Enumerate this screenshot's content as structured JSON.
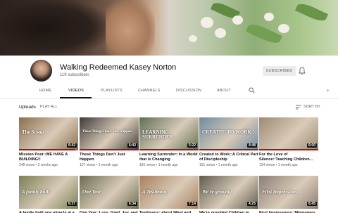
{
  "channel": {
    "name": "Walking Redeemed Kasey Norton",
    "subscribers": "119 subscribers",
    "subscribe_label": "SUBSCRIBED",
    "bell_icon": "bell-icon"
  },
  "tabs": [
    {
      "label": "HOME"
    },
    {
      "label": "VIDEOS"
    },
    {
      "label": "PLAYLISTS"
    },
    {
      "label": "CHANNELS"
    },
    {
      "label": "DISCUSSION"
    },
    {
      "label": "ABOUT"
    }
  ],
  "active_tab": "VIDEOS",
  "section": {
    "title": "Uploads",
    "play_all": "PLAY ALL",
    "sort_label": "SORT BY"
  },
  "videos_row1": [
    {
      "title": "Mission Post::WE HAVE A BUILDING!!",
      "meta": "248 views • 2 weeks ago",
      "duration": "6:42",
      "progress": 0.95,
      "overlay": "The Scoop",
      "accent": "#8b6f4e"
    },
    {
      "title": "These Things Don't Just Happen",
      "meta": "157 views • 1 month ago",
      "duration": "6:43",
      "progress": 1.0,
      "overlay": "These Things Don't Just Happen",
      "accent": "#3e3a38"
    },
    {
      "title": "Learning Surrender::In a World that is Changing",
      "meta": "166 views • 1 month ago",
      "duration": "5:22",
      "progress": 1.0,
      "overlay": "LEARNING SURRENDER",
      "accent": "#5f6e52"
    },
    {
      "title": "Created to Work::A Critical Part of Discipleship",
      "meta": "151 views • 1 month ago",
      "duration": "4:48",
      "progress": 1.0,
      "overlay": "CREATED TO WORK",
      "accent": "#6e8aa0"
    },
    {
      "title": "For the Love of Silence::Teaching Children...",
      "meta": "134 views • 1 month ago",
      "duration": "6:00",
      "progress": 1.0,
      "overlay": "",
      "accent": "#9c8a73"
    }
  ],
  "videos_row2": [
    {
      "title": "A family built one miracle at a",
      "meta": "",
      "duration": "6:37",
      "progress": 0.0,
      "overlay": "A family built",
      "accent": "#7a7f55"
    },
    {
      "title": "One Year::Loss, Grief, Joy, and",
      "meta": "",
      "duration": "6:34",
      "progress": 0.0,
      "overlay": "One Year",
      "accent": "#6c6c50"
    },
    {
      "title": "Testimony::about Wind and",
      "meta": "",
      "duration": "7:14",
      "progress": 0.0,
      "overlay": "A Testimony",
      "accent": "#a87f5c"
    },
    {
      "title": "We're provided Children in",
      "meta": "",
      "duration": "4:25",
      "progress": 0.0,
      "overlay": "We're growing",
      "accent": "#5e5b4e"
    },
    {
      "title": "First Impressions::Missionary",
      "meta": "",
      "duration": "6:45",
      "progress": 0.0,
      "overlay": "First Impressions",
      "accent": "#8c7c74"
    }
  ]
}
